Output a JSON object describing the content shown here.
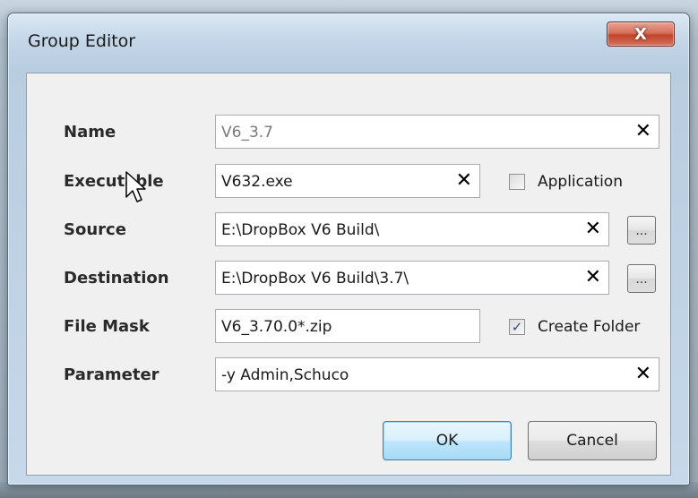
{
  "window": {
    "title": "Group Editor",
    "close_glyph": "X"
  },
  "form": {
    "name": {
      "label": "Name",
      "value": "V6_3.7"
    },
    "executable": {
      "label": "Executable",
      "value": "V632.exe"
    },
    "application": {
      "label": "Application",
      "checked": false
    },
    "source": {
      "label": "Source",
      "value": "E:\\DropBox V6 Build\\"
    },
    "destination": {
      "label": "Destination",
      "value": "E:\\DropBox V6 Build\\3.7\\"
    },
    "file_mask": {
      "label": "File Mask",
      "value": "V6_3.70.0*.zip"
    },
    "create_folder": {
      "label": "Create Folder",
      "checked": true
    },
    "parameter": {
      "label": "Parameter",
      "value": "-y Admin,Schuco"
    }
  },
  "glyphs": {
    "clear": "✕",
    "browse": "...",
    "check": "✓"
  },
  "buttons": {
    "ok": "OK",
    "cancel": "Cancel"
  },
  "colors": {
    "close_button": "#c8472d",
    "default_button_border": "#3c7fb1",
    "title_bar": "#c3d6e8"
  },
  "icons": {
    "close": "close-icon",
    "clear": "clear-icon",
    "browse": "ellipsis-icon",
    "cursor": "mouse-pointer-icon"
  }
}
